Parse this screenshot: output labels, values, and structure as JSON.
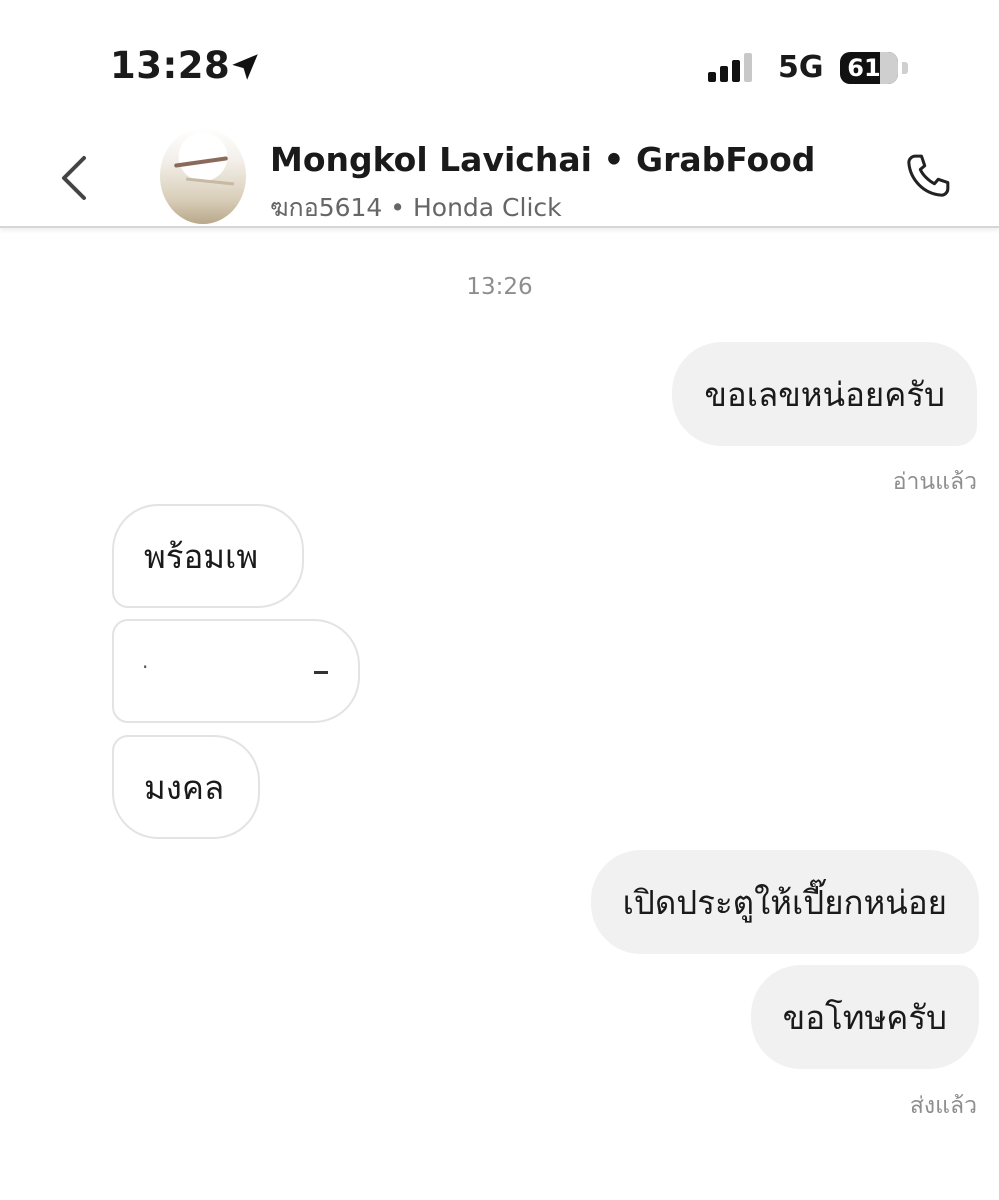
{
  "status_bar": {
    "time": "13:28",
    "location_icon": "location-arrow-icon",
    "signal_icon": "cellular-signal-icon",
    "network": "5G",
    "battery_percent": "61",
    "battery_level": 0.61
  },
  "header": {
    "back_icon": "chevron-left-icon",
    "contact_name": "Mongkol Lavichai • GrabFood",
    "contact_sub": "ฆกอ5614 • Honda Click",
    "call_icon": "phone-icon"
  },
  "chat": {
    "timestamp": "13:26",
    "messages": [
      {
        "direction": "outgoing",
        "text": "ขอเลขหน่อยครับ"
      },
      {
        "direction": "incoming",
        "text": "พร้อมเพ"
      },
      {
        "direction": "incoming",
        "text": ""
      },
      {
        "direction": "incoming",
        "text": "มงคล"
      },
      {
        "direction": "outgoing",
        "text": "เปิดประตูให้เปี๊ยกหน่อย"
      },
      {
        "direction": "outgoing",
        "text": "ขอโทษครับ"
      }
    ],
    "read_status": "อ่านแล้ว",
    "sent_status": "ส่งแล้ว"
  },
  "colors": {
    "outgoing_bubble": "#f1f1f1",
    "incoming_border": "#e3e3e3",
    "meta_text": "#8e8e8e"
  }
}
